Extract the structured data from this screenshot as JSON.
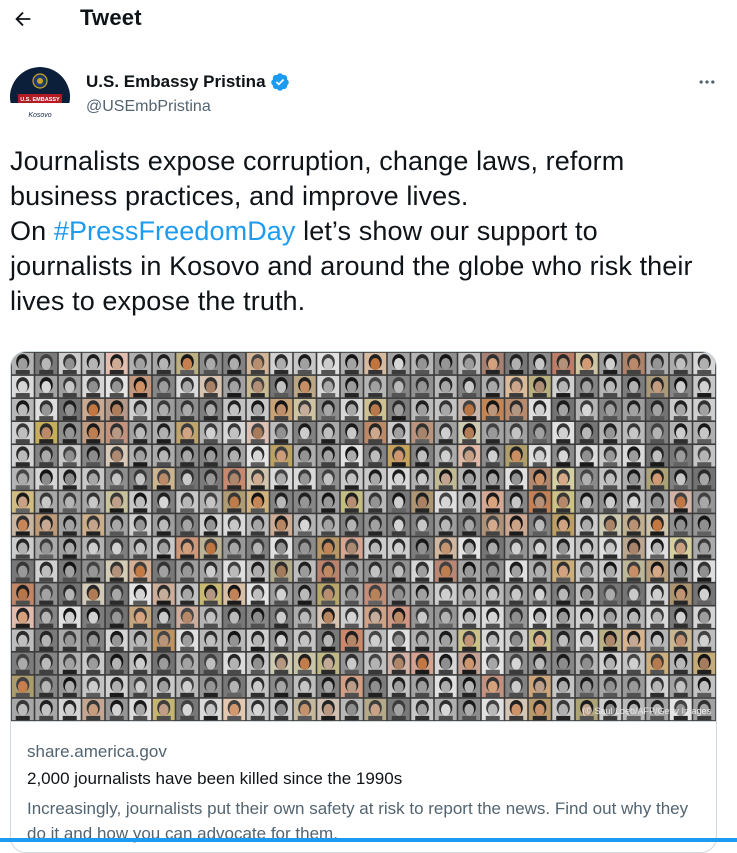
{
  "header": {
    "title": "Tweet",
    "back_icon": "arrow-left-icon"
  },
  "author": {
    "name": "U.S. Embassy Pristina",
    "handle": "@USEmbPristina",
    "avatar_banner": "U.S. EMBASSY",
    "avatar_caption": "Kosovo",
    "verified_icon": "verified-badge-icon",
    "verified_color": "#1d9bf0",
    "more_icon": "more-horizontal-icon"
  },
  "tweet": {
    "text_line1": "Journalists expose corruption, change laws, reform business practices, and improve lives.",
    "text_prefix": "On ",
    "hashtag": "#PressFreedomDay",
    "text_suffix": " let’s show our support to journalists in Kosovo and around the globe who risk their lives to expose the truth.",
    "hashtag_color": "#1d9bf0"
  },
  "card": {
    "image_description_credit": "(© Saul Loeb/AFP/Getty Images",
    "domain": "share.america.gov",
    "title": "2,000 journalists have been killed since the 1990s",
    "description": "Increasingly, journalists put their own safety at risk to report the news. Find out why they do it and how you can advocate for them."
  },
  "colors": {
    "accent": "#1d9bf0",
    "text_primary": "#0f1419",
    "text_secondary": "#536471",
    "border": "#cfd9de"
  }
}
